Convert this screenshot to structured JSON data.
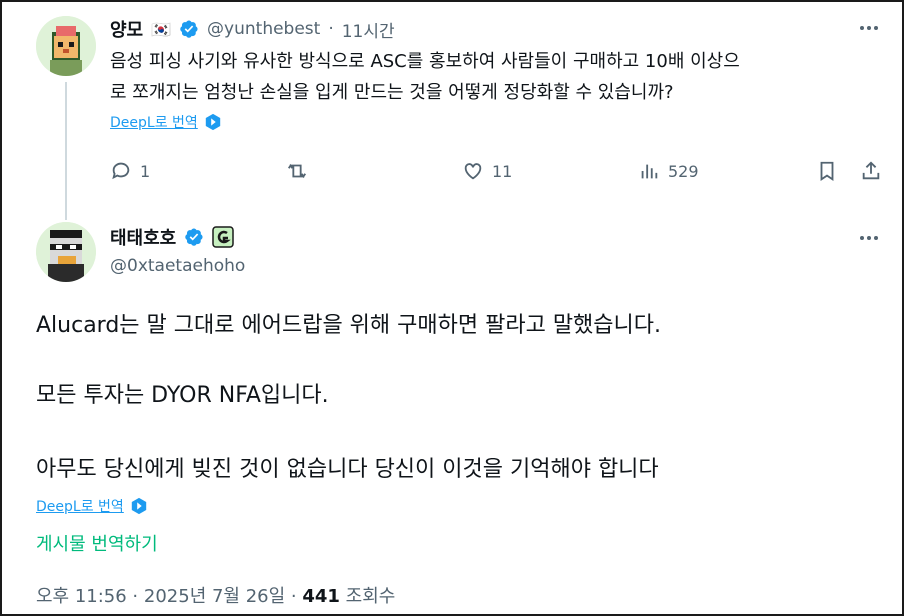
{
  "reply_tweet": {
    "display_name": "양모",
    "flag": "🇰🇷",
    "handle": "@yunthebest",
    "separator": "·",
    "time_ago": "11시간",
    "text_line1": "음성 피싱 사기와 유사한 방식으로 ASC를 홍보하여 사람들이 구매하고 10배 이상으",
    "text_line2": "로 쪼개지는 엄청난 손실을 입게 만드는 것을 어떻게 정당화할 수 있습니까?",
    "translate_label": "DeepL로 번역",
    "actions": {
      "reply_count": "1",
      "retweet_count": "",
      "like_count": "11",
      "views_count": "529"
    }
  },
  "main_tweet": {
    "display_name": "태태호호",
    "handle": "@0xtaetaehoho",
    "paragraph1": "Alucard는 말 그대로 에어드랍을 위해 구매하면 팔라고 말했습니다.",
    "paragraph2": "모든 투자는 DYOR NFA입니다.",
    "paragraph3": "아무도 당신에게 빚진 것이 없습니다 당신이 이것을 기억해야 합니다",
    "translate_label": "DeepL로 번역",
    "translate_post_label": "게시물 번역하기",
    "timestamp": "오후 11:56 · 2025년 7월 26일 · ",
    "views_count": "441",
    "views_label": " 조회수"
  },
  "colors": {
    "accent_blue": "#1d9bf0",
    "green": "#00ba7c",
    "muted": "#536471",
    "text": "#0f1419"
  }
}
